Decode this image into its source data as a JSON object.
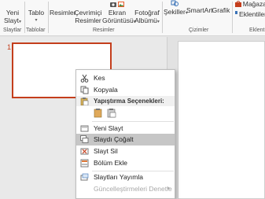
{
  "ribbon": {
    "groups": {
      "slides": "Slaytlar",
      "tables": "Tablolar",
      "images": "Resimler",
      "illustrations": "Çizimler",
      "addins": "Eklent"
    },
    "buttons": {
      "new_slide_1": "Yeni",
      "new_slide_2": "Slayt",
      "table": "Tablo",
      "pictures": "Resimler",
      "online_1": "Çevrimiçi",
      "online_2": "Resimler",
      "screenshot_1": "Ekran",
      "screenshot_2": "Görüntüsü",
      "album_1": "Fotoğraf",
      "album_2": "Albümü",
      "shapes": "Şekiller",
      "smartart": "SmartArt",
      "chart": "Grafik",
      "store": "Mağaza",
      "addins": "Eklentiler"
    }
  },
  "thumbnails": {
    "slide_number": "1"
  },
  "context_menu": {
    "cut": "Kes",
    "copy": "Kopyala",
    "paste_options": "Yapıştırma Seçenekleri:",
    "new_slide": "Yeni Slayt",
    "duplicate_slide": "Slaydı Çoğalt",
    "delete_slide": "Slayt Sil",
    "add_section": "Bölüm Ekle",
    "publish_slides": "Slaytları Yayımla",
    "check_updates": "Güncelleştirmeleri Denetle"
  },
  "colors": {
    "accent": "#c43e1c",
    "highlight": "#c6c6c6"
  }
}
